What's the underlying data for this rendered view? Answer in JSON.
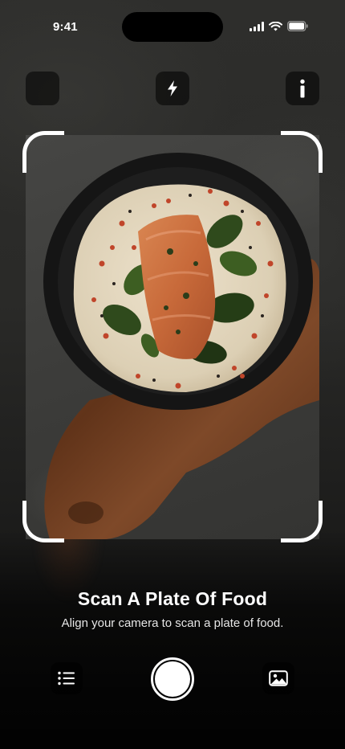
{
  "status_bar": {
    "time": "9:41",
    "icons": [
      "cellular-signal-icon",
      "wifi-icon",
      "battery-icon"
    ]
  },
  "top_controls": {
    "left_icon": "blank-button",
    "center_icon": "flash-icon",
    "right_icon": "info-icon"
  },
  "viewfinder": {
    "subject": "salmon-plate-photo"
  },
  "content": {
    "title": "Scan A Plate Of Food",
    "subtitle": "Align your camera to scan a plate of food."
  },
  "bottom_controls": {
    "left_icon": "list-icon",
    "center_icon": "shutter-button",
    "right_icon": "gallery-icon"
  },
  "colors": {
    "accent": "#ffffff",
    "background": "#2b2b29",
    "button_bg": "#0d0d0d"
  }
}
